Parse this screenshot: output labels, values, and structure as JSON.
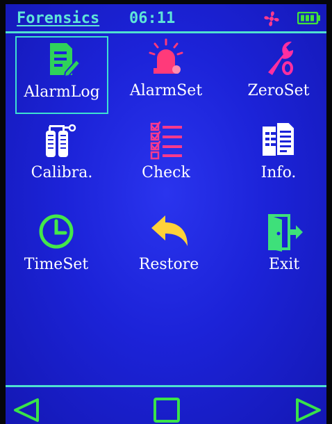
{
  "status": {
    "title": "Forensics",
    "time": "06:11",
    "fan_icon": "fan-icon",
    "battery_icon": "battery-icon",
    "colors": {
      "text": "#5fe5d8",
      "fan": "#ff3a8c",
      "battery": "#41e23a"
    }
  },
  "menu": {
    "selected": "AlarmLog",
    "items": [
      {
        "label": "AlarmLog",
        "icon": "document-edit-icon"
      },
      {
        "label": "AlarmSet",
        "icon": "alarm-beacon-icon"
      },
      {
        "label": "ZeroSet",
        "icon": "wrench-icon"
      },
      {
        "label": "Calibra.",
        "icon": "gas-cylinders-icon"
      },
      {
        "label": "Check",
        "icon": "checklist-icon"
      },
      {
        "label": "Info.",
        "icon": "info-document-icon"
      },
      {
        "label": "TimeSet",
        "icon": "clock-icon"
      },
      {
        "label": "Restore",
        "icon": "undo-arrow-icon"
      },
      {
        "label": "Exit",
        "icon": "exit-door-icon"
      }
    ]
  },
  "nav": {
    "left_icon": "left-triangle-icon",
    "center_icon": "square-icon",
    "right_icon": "right-triangle-icon",
    "color": "#39e34a"
  },
  "colors": {
    "background": "#1c23d8",
    "accent": "#3ee0d0",
    "label": "#ffffff"
  }
}
